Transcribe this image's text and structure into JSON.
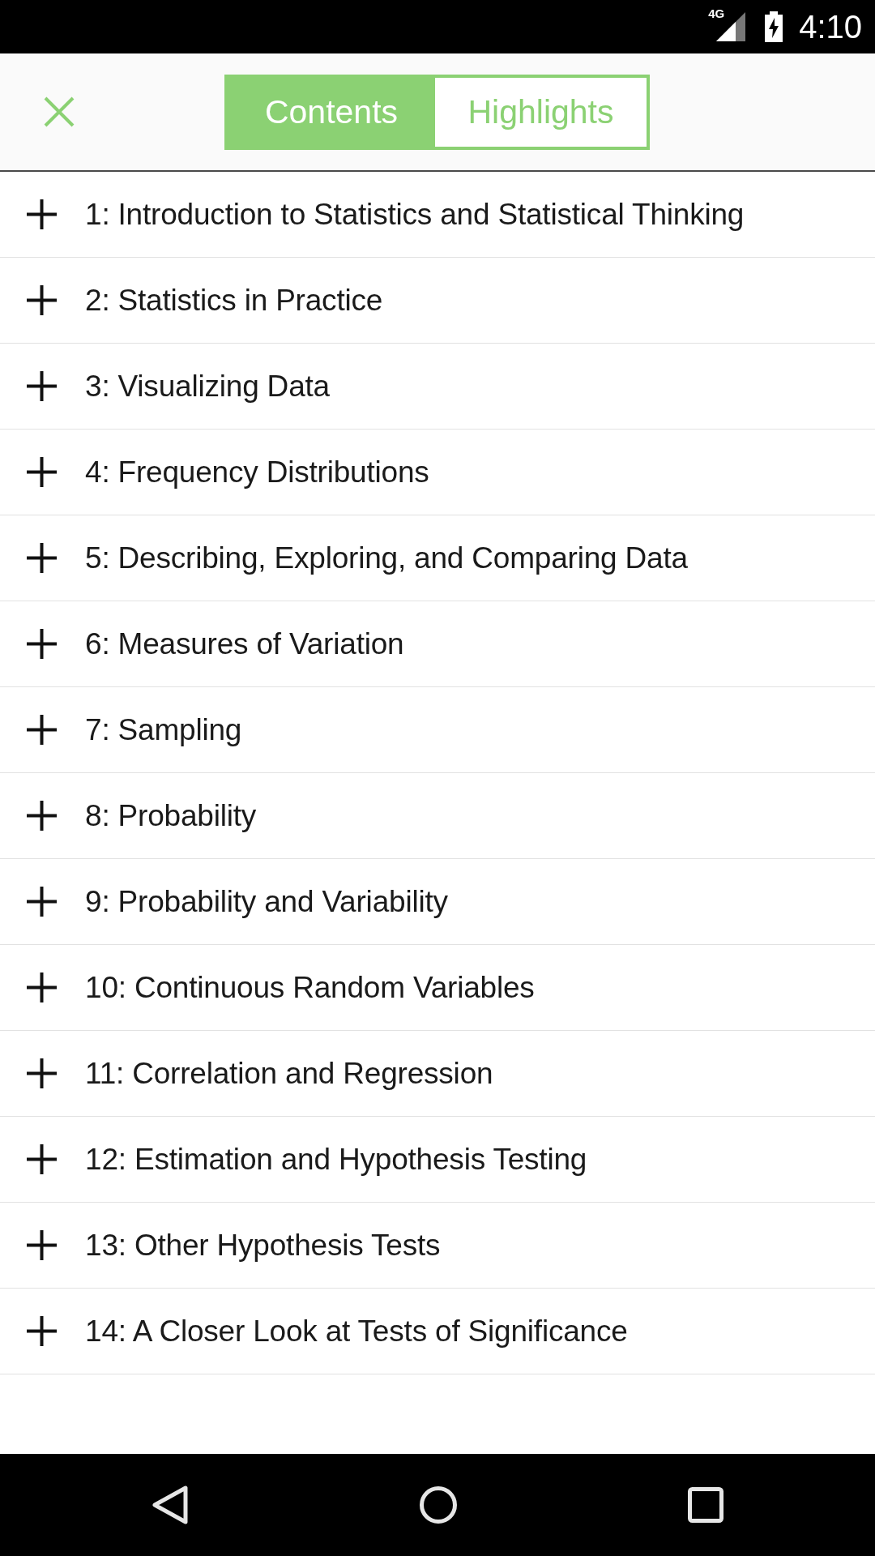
{
  "status_bar": {
    "network": "4G",
    "time": "4:10"
  },
  "header": {
    "tabs": [
      {
        "label": "Contents",
        "selected": true
      },
      {
        "label": "Highlights",
        "selected": false
      }
    ]
  },
  "chapters": [
    {
      "label": "1: Introduction to Statistics and Statistical Thinking",
      "expanded": false
    },
    {
      "label": "2: Statistics in Practice",
      "expanded": false
    },
    {
      "label": "3: Visualizing Data",
      "expanded": false
    },
    {
      "label": "4: Frequency Distributions",
      "expanded": false
    },
    {
      "label": "5: Describing, Exploring, and Comparing Data",
      "expanded": false
    },
    {
      "label": "6: Measures of Variation",
      "expanded": false
    },
    {
      "label": "7: Sampling",
      "expanded": false
    },
    {
      "label": "8: Probability",
      "expanded": false
    },
    {
      "label": "9: Probability and Variability",
      "expanded": false
    },
    {
      "label": "10: Continuous Random Variables",
      "expanded": false
    },
    {
      "label": "11: Correlation and Regression",
      "expanded": false
    },
    {
      "label": "12: Estimation and Hypothesis Testing",
      "expanded": false
    },
    {
      "label": "13: Other Hypothesis Tests",
      "expanded": false
    },
    {
      "label": "14: A Closer Look at Tests of Significance",
      "expanded": false
    }
  ]
}
